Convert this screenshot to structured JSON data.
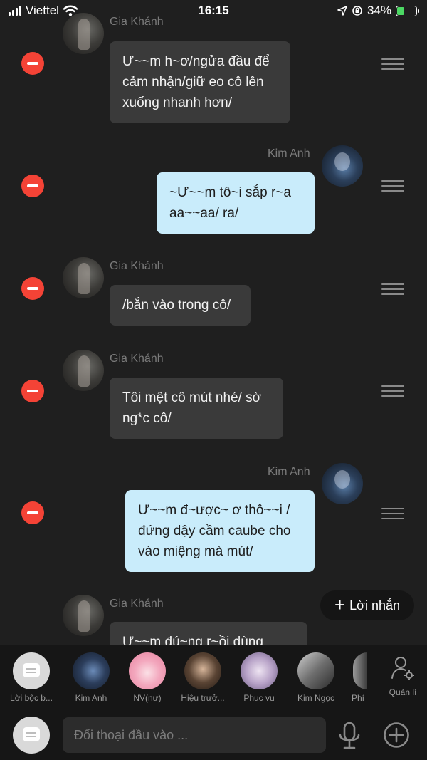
{
  "status_bar": {
    "carrier": "Viettel",
    "time": "16:15",
    "battery": "34%",
    "battery_level": 0.34
  },
  "messages": [
    {
      "sender": "Gia Khánh",
      "side": "in",
      "text": "Ư~~m h~ơ/ngửa đầu để cảm nhận/giữ eo cô lên xuống nhanh hơn/",
      "show_name": false
    },
    {
      "sender": "Kim Anh",
      "side": "out",
      "text": "~Ư~~m tô~i sắp r~a aa~~aa/ ra/",
      "show_name": true
    },
    {
      "sender": "Gia Khánh",
      "side": "in",
      "text": "/bắn vào trong cô/",
      "show_name": true
    },
    {
      "sender": "Gia Khánh",
      "side": "in",
      "text": "Tôi mệt cô mút nhé/ sờ ng*c cô/",
      "show_name": true
    },
    {
      "sender": "Kim Anh",
      "side": "out",
      "text": "Ư~~m đ~ược~ ơ thô~~i / đứng dậy cầm caube cho vào miệng mà mút/",
      "show_name": true
    },
    {
      "sender": "Gia Khánh",
      "side": "in",
      "text": "Ư~~m đú~ng r~ồi dùng",
      "show_name": true
    }
  ],
  "reply_button": {
    "label": "Lời nhắn"
  },
  "contacts": [
    {
      "name": "Lời bộc b..."
    },
    {
      "name": "Kim Anh"
    },
    {
      "name": "NV(nư)"
    },
    {
      "name": "Hiệu trưở..."
    },
    {
      "name": "Phục vụ"
    },
    {
      "name": "Kim Ngọc"
    },
    {
      "name": "Phí"
    }
  ],
  "manage": {
    "label": "Quản lí"
  },
  "input": {
    "placeholder": "Đối thoại đầu vào ..."
  },
  "colors": {
    "background": "#1f1f1f",
    "incoming_bubble": "#3a3a3a",
    "outgoing_bubble": "#c9ecfb",
    "remove_button": "#f44336"
  }
}
